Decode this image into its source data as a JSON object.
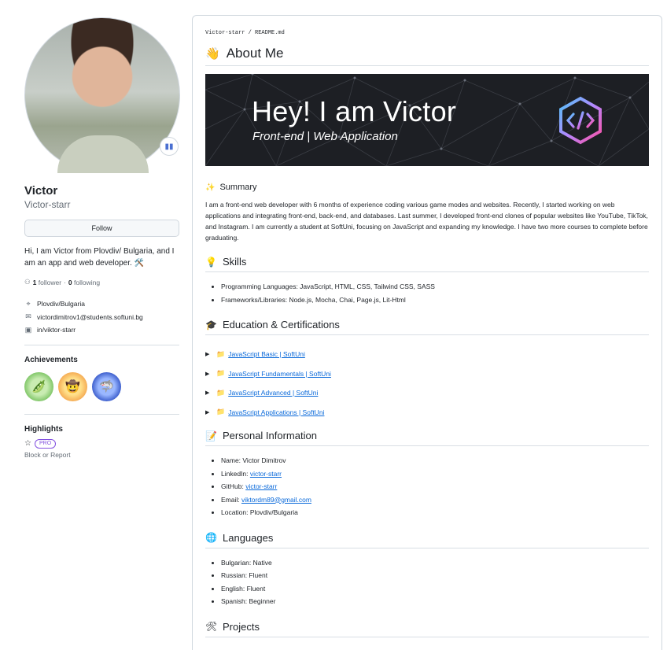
{
  "profile": {
    "name": "Victor",
    "username": "Victor-starr",
    "follow_label": "Follow",
    "status_emoji_icon": "bar-chart-icon",
    "bio": "Hi, I am Victor from Plovdiv/ Bulgaria, and I am an app and web developer. 🛠️",
    "followers_count": "1",
    "followers_label": "follower",
    "following_sep": "·",
    "following_count": "0",
    "following_label": "following",
    "location": "Plovdiv/Bulgaria",
    "email": "victordimitrov1@students.softuni.bg",
    "linkedin": "in/viktor-starr",
    "achievements_title": "Achievements",
    "highlights_title": "Highlights",
    "pro_label": "PRO",
    "block_label": "Block or Report"
  },
  "readme": {
    "breadcrumb": "Victor-starr / README.md",
    "about_title": "About Me",
    "banner": {
      "title": "Hey! I am Victor",
      "subtitle": "Front-end | Web Application"
    },
    "summary_title": "Summary",
    "summary_text": "I am a front-end web developer with 6 months of experience coding various game modes and websites. Recently, I started working on web applications and integrating front-end, back-end, and databases. Last summer, I developed front-end clones of popular websites like YouTube, TikTok, and Instagram. I am currently a student at SoftUni, focusing on JavaScript and expanding my knowledge. I have two more courses to complete before graduating.",
    "skills_title": "Skills",
    "skills": [
      {
        "label": "Programming Languages:",
        "value": " JavaScript, HTML, CSS, Tailwind CSS, SASS"
      },
      {
        "label": "Frameworks/Libraries:",
        "value": " Node.js, Mocha, Chai, Page.js, Lit-Html"
      }
    ],
    "education_title": "Education & Certifications",
    "education": [
      "JavaScript Basic | SoftUni",
      "JavaScript Fundamentals | SoftUni",
      "JavaScript Advanced | SoftUni",
      "JavaScript Applications | SoftUni"
    ],
    "personal_title": "Personal Information",
    "personal": {
      "name_label": "Name:",
      "name_value": " Victor Dimitrov",
      "linkedin_label": "LinkedIn:",
      "linkedin_value": "victor-starr",
      "github_label": "GitHub:",
      "github_value": "victor-starr",
      "email_label": "Email:",
      "email_value": "viktordm89@gmail.com",
      "location_label": "Location:",
      "location_value": " Plovdiv/Bulgaria"
    },
    "languages_title": "Languages",
    "languages": [
      "Bulgarian: Native",
      "Russian: Fluent",
      "English: Fluent",
      "Spanish: Beginner"
    ],
    "projects_title": "Projects"
  },
  "colors": {
    "link": "#0969da",
    "pro": "#8250df",
    "banner_bg": "#1d1f24"
  }
}
